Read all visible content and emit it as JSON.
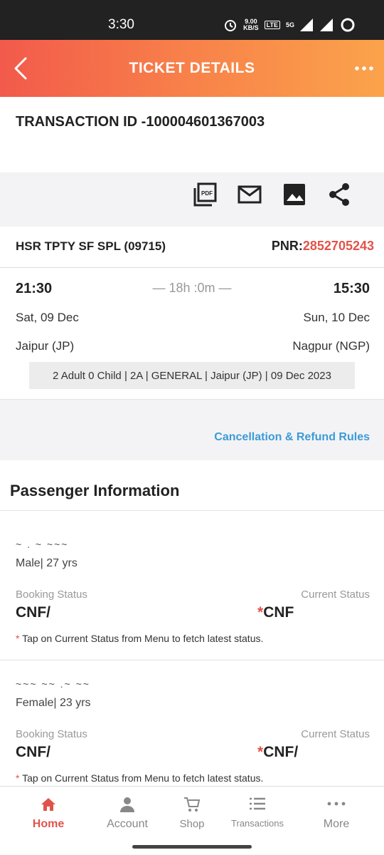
{
  "status_bar": {
    "time": "3:30",
    "net_speed": "9.00",
    "net_unit": "KB/S",
    "lte": "LTE",
    "network": "5G"
  },
  "header": {
    "title": "TICKET DETAILS"
  },
  "transaction": {
    "label": "TRANSACTION ID -100004601367003"
  },
  "actions": [
    "pdf-icon",
    "mail-icon",
    "image-icon",
    "share-icon"
  ],
  "train": {
    "name": "HSR TPTY SF SPL  (09715)",
    "pnr_label": "PNR:",
    "pnr_value": "2852705243"
  },
  "journey": {
    "departure_time": "21:30",
    "arrival_time": "15:30",
    "duration": "— 18h :0m —",
    "departure_date": "Sat, 09 Dec",
    "arrival_date": "Sun, 10 Dec",
    "from_station": "Jaipur (JP)",
    "to_station": "Nagpur (NGP)",
    "summary": "2 Adult 0 Child  | 2A | GENERAL | Jaipur (JP) | 09 Dec 2023"
  },
  "rules": {
    "link": "Cancellation & Refund Rules"
  },
  "passengers_section": {
    "title": "Passenger Information",
    "passengers": [
      {
        "name": "~  . ~  ~~~",
        "meta": "Male| 27 yrs",
        "booking_label": "Booking Status",
        "current_label": "Current Status",
        "booking_value": "CNF/",
        "current_value": "CNF",
        "note_text": " Tap on Current Status from Menu to fetch latest status."
      },
      {
        "name": "~~~  ~~ .~ ~~",
        "meta": "Female| 23 yrs",
        "booking_label": "Booking Status",
        "current_label": "Current Status",
        "booking_value": "CNF/",
        "current_value": "CNF/",
        "note_text": " Tap on Current Status from Menu to fetch latest status."
      }
    ]
  },
  "bottom_nav": [
    {
      "label": "Home",
      "icon": "home-icon",
      "active": true
    },
    {
      "label": "Account",
      "icon": "account-icon",
      "active": false
    },
    {
      "label": "Shop",
      "icon": "cart-icon",
      "active": false
    },
    {
      "label": "Transactions",
      "icon": "list-icon",
      "active": false
    },
    {
      "label": "More",
      "icon": "more-icon",
      "active": false
    }
  ],
  "colors": {
    "accent": "#e0534a",
    "link": "#3b9bd8",
    "header_gradient_start": "#f25a4b",
    "header_gradient_end": "#fba34b"
  }
}
